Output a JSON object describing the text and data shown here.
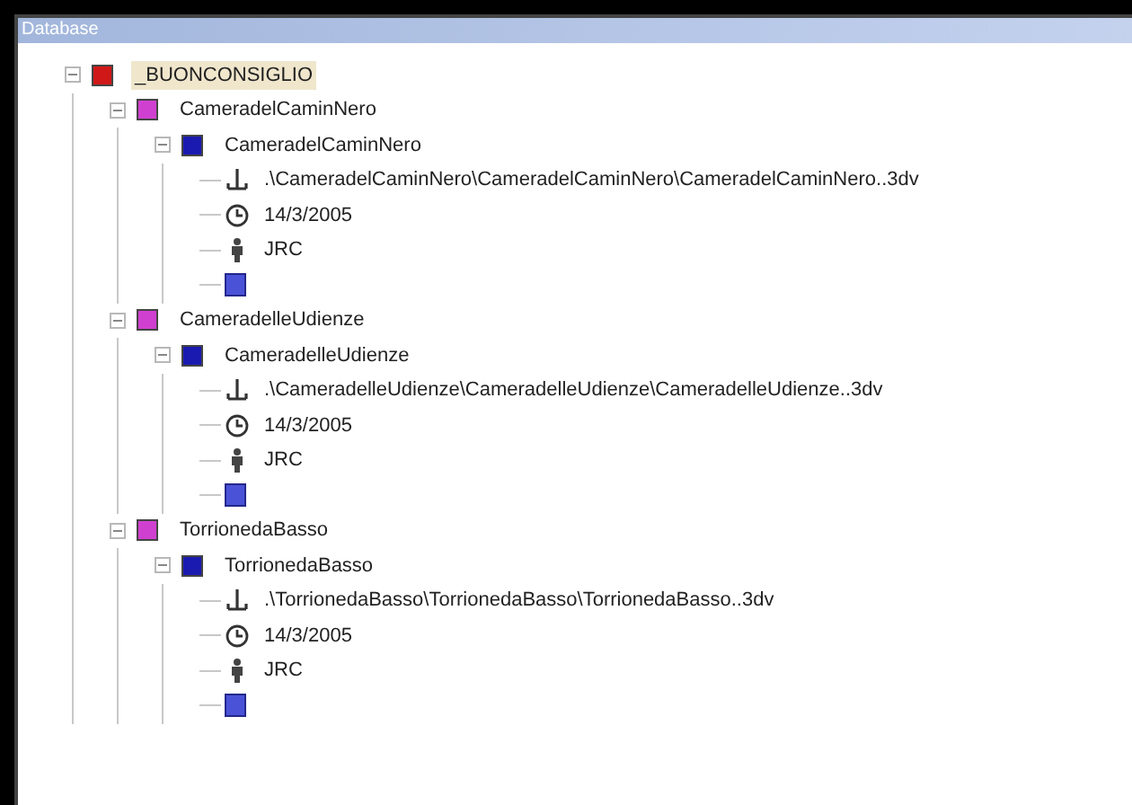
{
  "panel": {
    "title": "Database"
  },
  "tree": {
    "label": "_BUONCONSIGLIO",
    "kind": "database",
    "expanded": true,
    "selected": true,
    "children": [
      {
        "label": "CameradelCaminNero",
        "kind": "group",
        "expanded": true,
        "selected": false,
        "children": [
          {
            "label": "CameradelCaminNero",
            "kind": "model",
            "expanded": true,
            "selected": false,
            "children": [
              {
                "kind": "path",
                "label": ".\\CameradelCaminNero\\CameradelCaminNero\\CameradelCaminNero..3dv"
              },
              {
                "kind": "date",
                "label": "14/3/2005"
              },
              {
                "kind": "author",
                "label": "JRC"
              },
              {
                "kind": "preview"
              }
            ]
          }
        ]
      },
      {
        "label": "CameradelleUdienze",
        "kind": "group",
        "expanded": true,
        "selected": false,
        "children": [
          {
            "label": "CameradelleUdienze",
            "kind": "model",
            "expanded": true,
            "selected": false,
            "children": [
              {
                "kind": "path",
                "label": ".\\CameradelleUdienze\\CameradelleUdienze\\CameradelleUdienze..3dv"
              },
              {
                "kind": "date",
                "label": "14/3/2005"
              },
              {
                "kind": "author",
                "label": "JRC"
              },
              {
                "kind": "preview"
              }
            ]
          }
        ]
      },
      {
        "label": "TorrionedaBasso",
        "kind": "group",
        "expanded": true,
        "selected": false,
        "children": [
          {
            "label": "TorrionedaBasso",
            "kind": "model",
            "expanded": true,
            "selected": false,
            "children": [
              {
                "kind": "path",
                "label": ".\\TorrionedaBasso\\TorrionedaBasso\\TorrionedaBasso..3dv"
              },
              {
                "kind": "date",
                "label": "14/3/2005"
              },
              {
                "kind": "author",
                "label": "JRC"
              },
              {
                "kind": "preview"
              }
            ]
          }
        ]
      }
    ]
  }
}
